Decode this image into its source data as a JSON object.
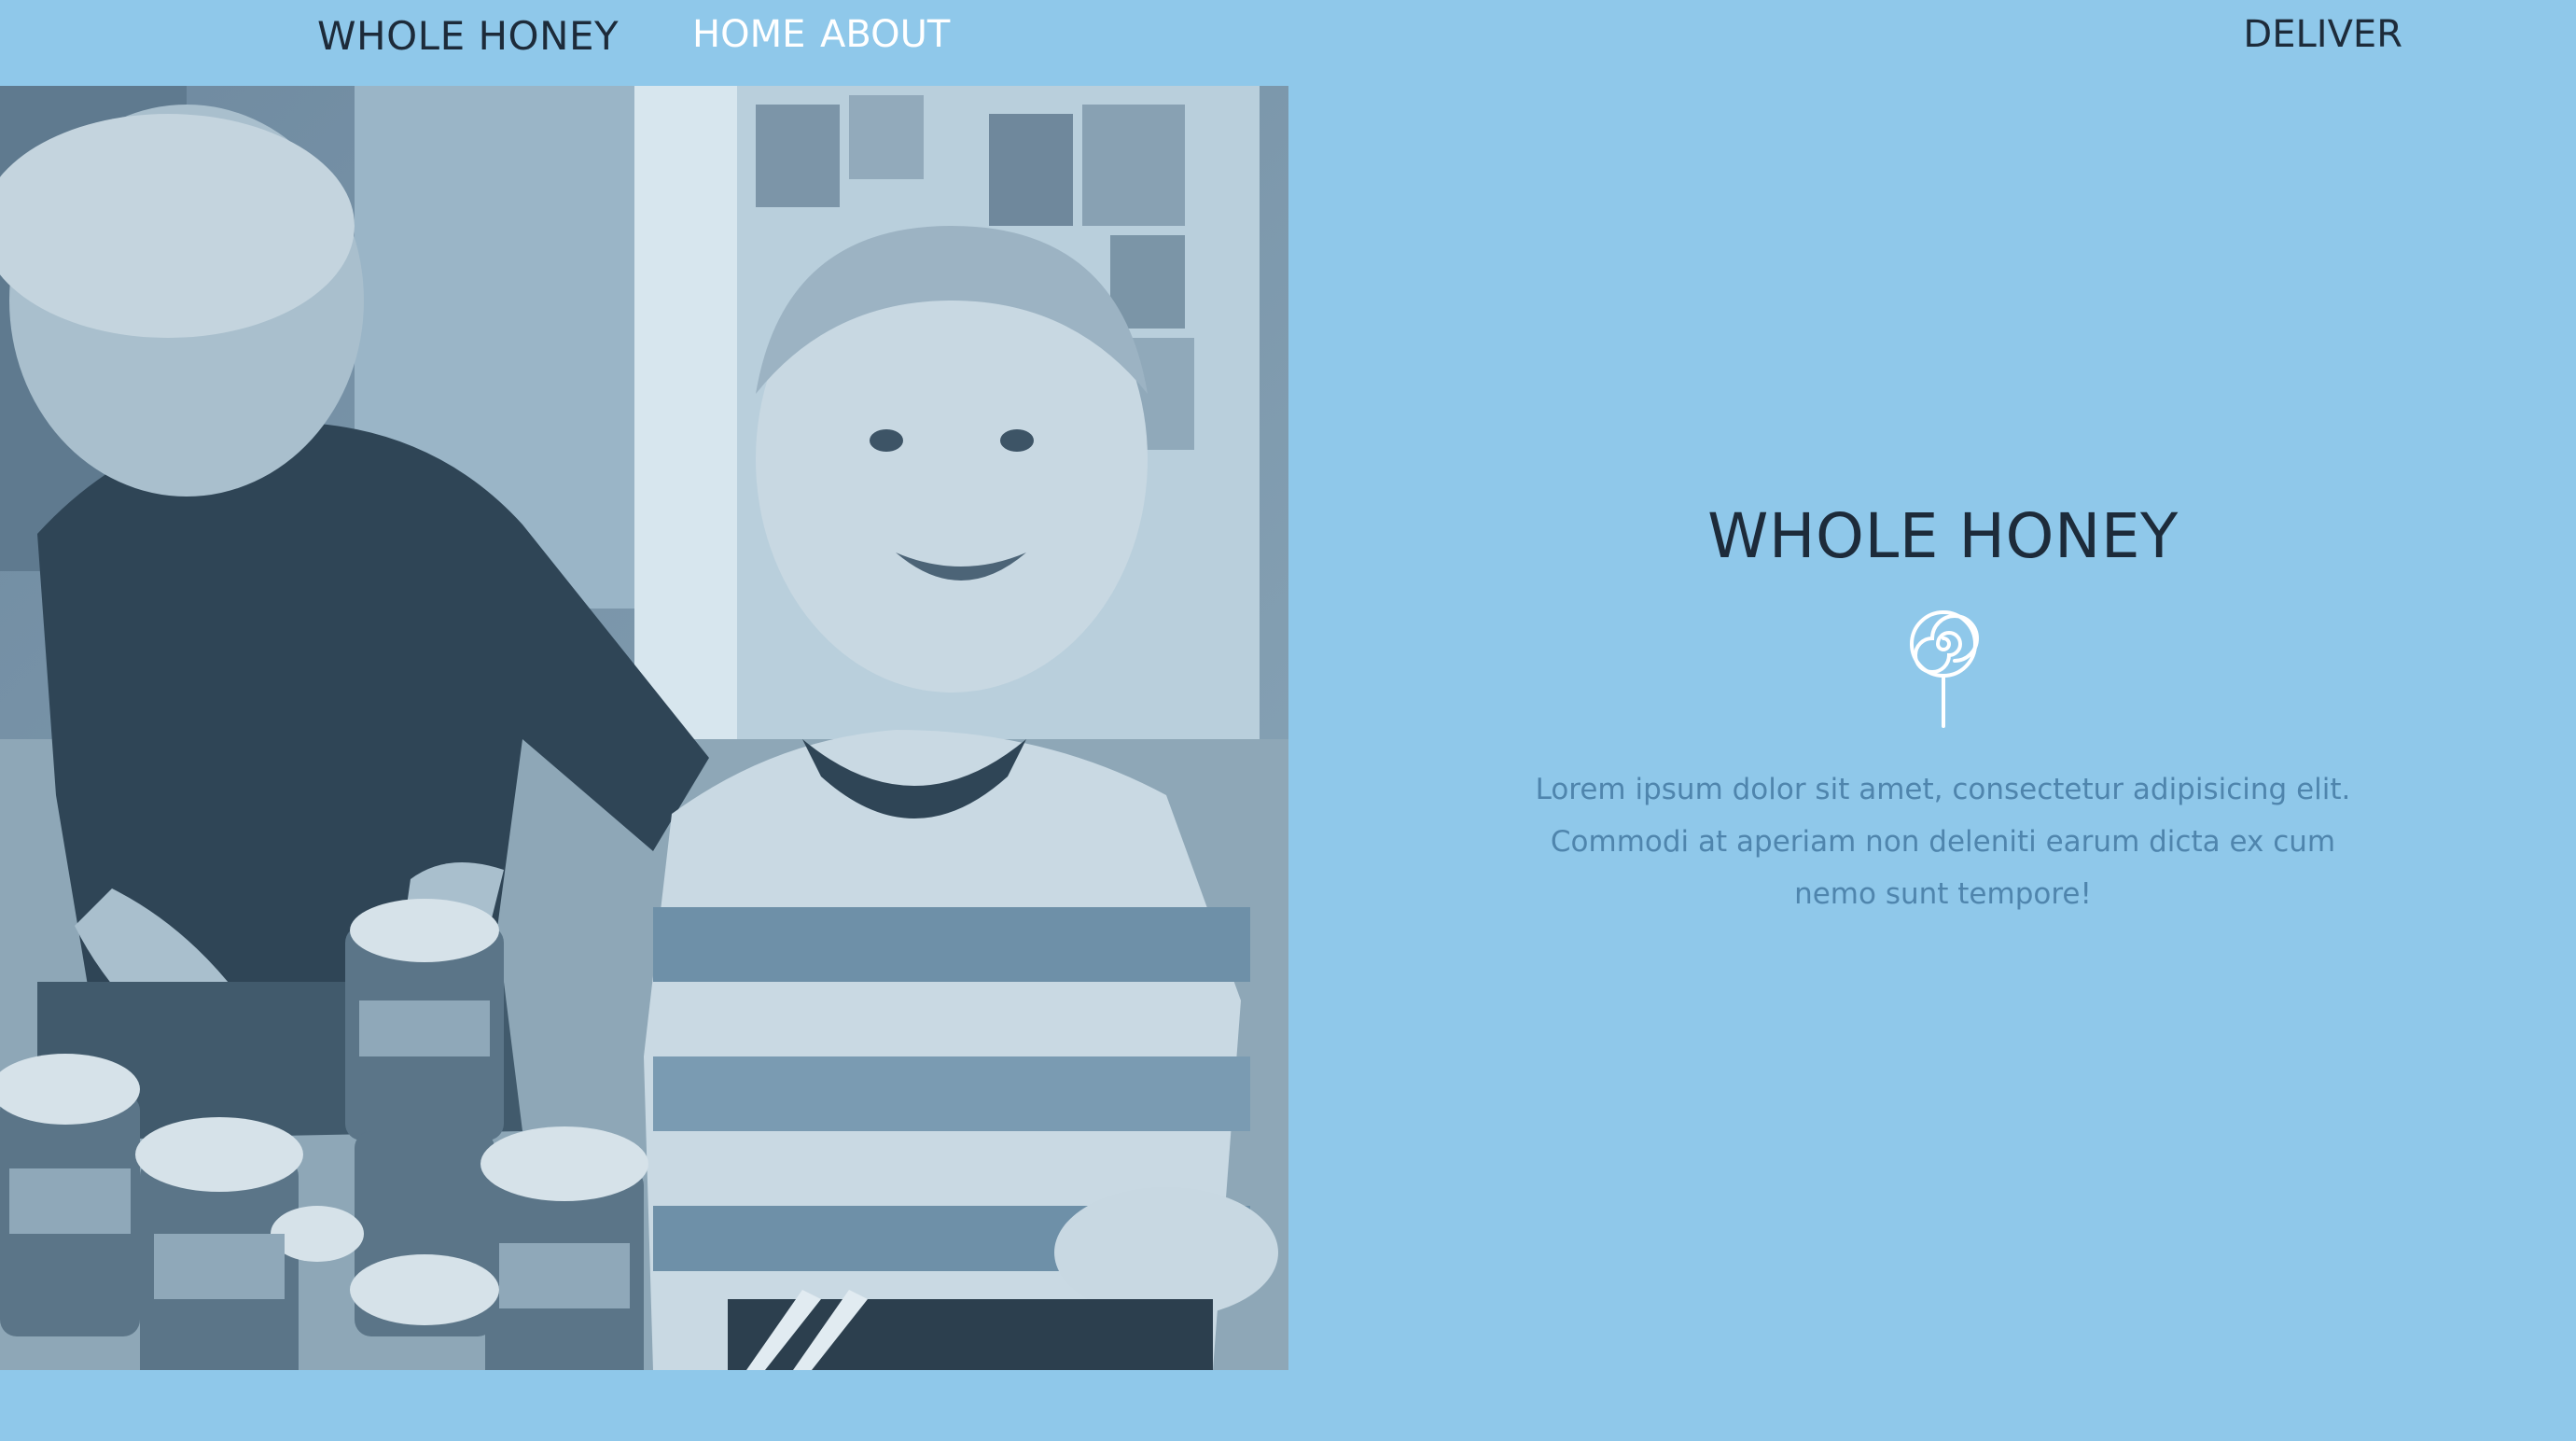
{
  "nav": {
    "brand": "WHOLE HONEY",
    "links": [
      {
        "label": "HOME"
      },
      {
        "label": "ABOUT"
      }
    ],
    "deliver_label": "DELIVER"
  },
  "hero": {
    "title": "WHOLE HONEY",
    "icon": "lollipop-icon",
    "paragraph": "Lorem ipsum dolor sit amet, consectetur adipisicing elit. Commodi at aperiam non deleniti earum dicta ex cum nemo sunt tempore!"
  },
  "colors": {
    "background": "#8fc8ea",
    "dark_text": "#1d2b3a",
    "link_text": "#ffffff",
    "body_text": "#4f85ad"
  }
}
